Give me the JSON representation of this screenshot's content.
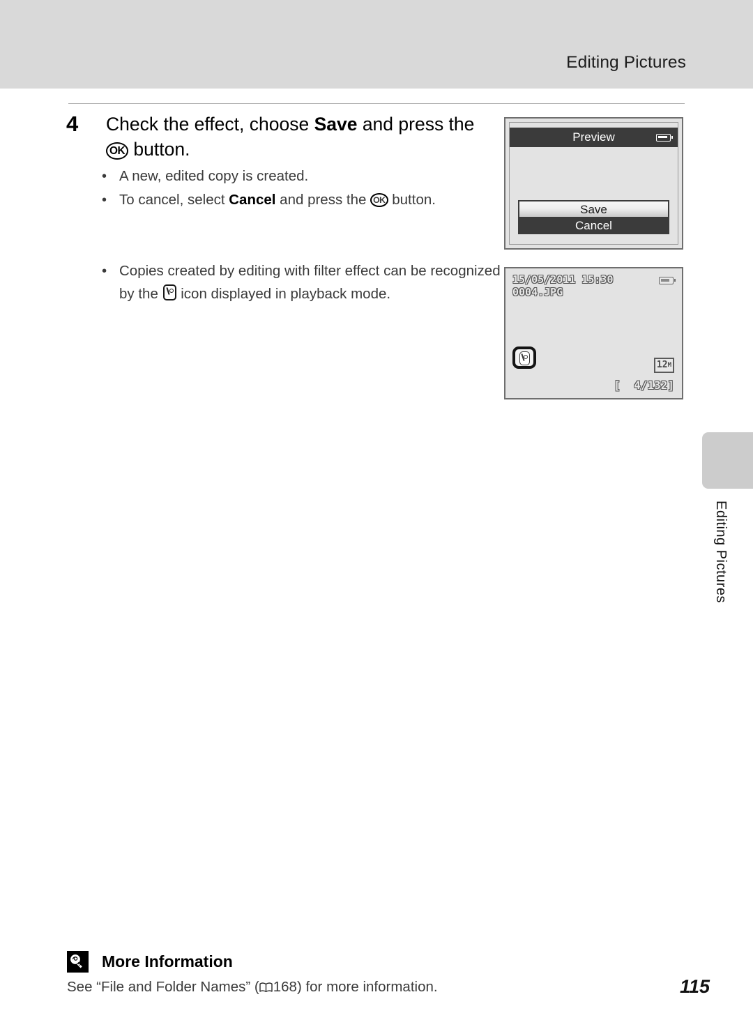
{
  "header": {
    "title": "Editing Pictures"
  },
  "step": {
    "number": "4",
    "heading_pre": "Check the effect, choose ",
    "heading_bold": "Save",
    "heading_mid": " and press the ",
    "heading_ok_icon": "ok-button-icon",
    "heading_post": " button.",
    "bullets": [
      {
        "marker": "•",
        "pre": "A new, edited copy is created.",
        "bold": "",
        "post": ""
      },
      {
        "marker": "•",
        "pre": "To cancel, select ",
        "bold": "Cancel",
        "post": " and press the ",
        "tail": " button."
      }
    ],
    "note": {
      "marker": "•",
      "pre": "Copies created by editing with filter effect can be recognized by the ",
      "icon": "filter-effect-icon",
      "post": " icon displayed in playback mode."
    }
  },
  "preview_screen": {
    "title": "Preview",
    "battery_icon": "battery-icon",
    "save_label": "Save",
    "cancel_label": "Cancel"
  },
  "playback_screen": {
    "datetime": "15/05/2011 15:30",
    "filename": "0004.JPG",
    "battery_icon": "battery-icon",
    "filter_badge_icon": "filter-effect-icon",
    "image_size_num": "12",
    "image_size_unit": "M",
    "frame_counter": "[  4/132]"
  },
  "side_tab": {
    "label": "Editing Pictures"
  },
  "footer": {
    "icon": "lightbulb-icon",
    "title": "More Information",
    "body_pre": "See “File and Folder Names” (",
    "body_icon": "book-icon",
    "body_page": "168",
    "body_post": ") for more information.",
    "page_number": "115"
  },
  "colors": {
    "header_band": "#d9d9d9",
    "side_tab": "#cccccc",
    "screen_bg": "#e3e3e3",
    "screen_dark": "#3b3b3b",
    "text": "#3a3a3a"
  }
}
